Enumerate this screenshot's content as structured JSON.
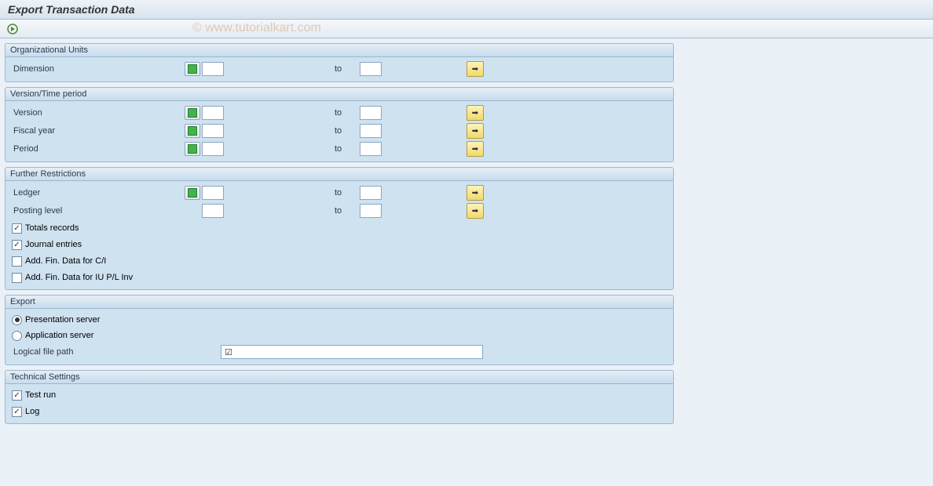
{
  "title": "Export Transaction Data",
  "watermark": "© www.tutorialkart.com",
  "sections": {
    "org": {
      "header": "Organizational Units",
      "dimension": "Dimension",
      "to": "to"
    },
    "version_time": {
      "header": "Version/Time period",
      "version": "Version",
      "fiscal_year": "Fiscal year",
      "period": "Period",
      "to": "to"
    },
    "restrictions": {
      "header": "Further Restrictions",
      "ledger": "Ledger",
      "posting_level": "Posting level",
      "to": "to",
      "totals_records": "Totals records",
      "journal_entries": "Journal entries",
      "add_fin_ci": "Add. Fin. Data for C/I",
      "add_fin_iu": "Add. Fin. Data for IU P/L Inv",
      "totals_checked": true,
      "journal_checked": true,
      "ci_checked": false,
      "iu_checked": false
    },
    "export": {
      "header": "Export",
      "presentation": "Presentation server",
      "application": "Application server",
      "logical_path": "Logical file path",
      "selected": "presentation",
      "path_value": ""
    },
    "technical": {
      "header": "Technical Settings",
      "test_run": "Test run",
      "log": "Log",
      "test_checked": true,
      "log_checked": true
    }
  }
}
